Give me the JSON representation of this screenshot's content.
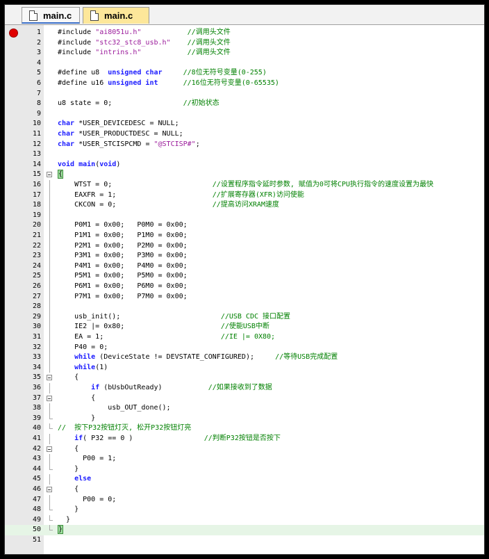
{
  "tabs": [
    {
      "label": "main.c",
      "active": false
    },
    {
      "label": "main.c",
      "active": true
    }
  ],
  "editor": {
    "breakpoint_line": 1,
    "current_line": 50,
    "lines": [
      {
        "n": "1",
        "segs": [
          [
            "",
            "#include "
          ],
          [
            "st",
            "\"ai8051u.h\""
          ],
          [
            "",
            "           "
          ],
          [
            "cm",
            "//调用头文件"
          ]
        ]
      },
      {
        "n": "2",
        "segs": [
          [
            "",
            "#include "
          ],
          [
            "st",
            "\"stc32_stc8_usb.h\""
          ],
          [
            "",
            "    "
          ],
          [
            "cm",
            "//调用头文件"
          ]
        ]
      },
      {
        "n": "3",
        "segs": [
          [
            "",
            "#include "
          ],
          [
            "st",
            "\"intrins.h\""
          ],
          [
            "",
            "           "
          ],
          [
            "cm",
            "//调用头文件"
          ]
        ]
      },
      {
        "n": "4",
        "segs": []
      },
      {
        "n": "5",
        "segs": [
          [
            "",
            "#define u8  "
          ],
          [
            "kw",
            "unsigned char"
          ],
          [
            "",
            "     "
          ],
          [
            "cm",
            "//8位无符号变量(0-255)"
          ]
        ]
      },
      {
        "n": "6",
        "segs": [
          [
            "",
            "#define u16 "
          ],
          [
            "kw",
            "unsigned int"
          ],
          [
            "",
            "      "
          ],
          [
            "cm",
            "//16位无符号变量(0-65535)"
          ]
        ]
      },
      {
        "n": "7",
        "segs": []
      },
      {
        "n": "8",
        "segs": [
          [
            "",
            "u8 state = 0;"
          ],
          [
            "",
            "                 "
          ],
          [
            "cm",
            "//初始状态"
          ]
        ]
      },
      {
        "n": "9",
        "segs": []
      },
      {
        "n": "10",
        "segs": [
          [
            "kw",
            "char"
          ],
          [
            "",
            " *USER_DEVICEDESC = NULL;"
          ]
        ]
      },
      {
        "n": "11",
        "segs": [
          [
            "kw",
            "char"
          ],
          [
            "",
            " *USER_PRODUCTDESC = NULL;"
          ]
        ]
      },
      {
        "n": "12",
        "segs": [
          [
            "kw",
            "char"
          ],
          [
            "",
            " *USER_STCISPCMD = "
          ],
          [
            "st",
            "\"@STCISP#\""
          ],
          [
            "",
            ";"
          ]
        ]
      },
      {
        "n": "13",
        "segs": []
      },
      {
        "n": "14",
        "segs": [
          [
            "kw",
            "void"
          ],
          [
            "",
            " "
          ],
          [
            "kw",
            "main"
          ],
          [
            "",
            "("
          ],
          [
            "kw",
            "void"
          ],
          [
            "",
            ")"
          ]
        ]
      },
      {
        "n": "15",
        "segs": [
          [
            "hl",
            "{"
          ]
        ]
      },
      {
        "n": "16",
        "segs": [
          [
            "",
            "    WTST = 0;"
          ],
          [
            "",
            "                        "
          ],
          [
            "cm",
            "//设置程序指令延时参数, 赋值为0可将CPU执行指令的速度设置为最快"
          ]
        ]
      },
      {
        "n": "17",
        "segs": [
          [
            "",
            "    EAXFR = 1;"
          ],
          [
            "",
            "                       "
          ],
          [
            "cm",
            "//扩展寄存器(XFR)访问使能"
          ]
        ]
      },
      {
        "n": "18",
        "segs": [
          [
            "",
            "    CKCON = 0;"
          ],
          [
            "",
            "                       "
          ],
          [
            "cm",
            "//提高访问XRAM速度"
          ]
        ]
      },
      {
        "n": "19",
        "segs": []
      },
      {
        "n": "20",
        "segs": [
          [
            "",
            "    P0M1 = 0x00;   P0M0 = 0x00;"
          ]
        ]
      },
      {
        "n": "21",
        "segs": [
          [
            "",
            "    P1M1 = 0x00;   P1M0 = 0x00;"
          ]
        ]
      },
      {
        "n": "22",
        "segs": [
          [
            "",
            "    P2M1 = 0x00;   P2M0 = 0x00;"
          ]
        ]
      },
      {
        "n": "23",
        "segs": [
          [
            "",
            "    P3M1 = 0x00;   P3M0 = 0x00;"
          ]
        ]
      },
      {
        "n": "24",
        "segs": [
          [
            "",
            "    P4M1 = 0x00;   P4M0 = 0x00;"
          ]
        ]
      },
      {
        "n": "25",
        "segs": [
          [
            "",
            "    P5M1 = 0x00;   P5M0 = 0x00;"
          ]
        ]
      },
      {
        "n": "26",
        "segs": [
          [
            "",
            "    P6M1 = 0x00;   P6M0 = 0x00;"
          ]
        ]
      },
      {
        "n": "27",
        "segs": [
          [
            "",
            "    P7M1 = 0x00;   P7M0 = 0x00;"
          ]
        ]
      },
      {
        "n": "28",
        "segs": []
      },
      {
        "n": "29",
        "segs": [
          [
            "",
            "    usb_init();"
          ],
          [
            "",
            "                        "
          ],
          [
            "cm",
            "//USB CDC 接口配置"
          ]
        ]
      },
      {
        "n": "30",
        "segs": [
          [
            "",
            "    IE2 |= 0x80;"
          ],
          [
            "",
            "                       "
          ],
          [
            "cm",
            "//使能USB中断"
          ]
        ]
      },
      {
        "n": "31",
        "segs": [
          [
            "",
            "    EA = 1;"
          ],
          [
            "",
            "                            "
          ],
          [
            "cm",
            "//IE |= 0X80;"
          ]
        ]
      },
      {
        "n": "32",
        "segs": [
          [
            "",
            "    P40 = 0;"
          ]
        ]
      },
      {
        "n": "33",
        "segs": [
          [
            "",
            "    "
          ],
          [
            "kw",
            "while"
          ],
          [
            "",
            " (DeviceState != DEVSTATE_CONFIGURED);     "
          ],
          [
            "cm",
            "//等待USB完成配置"
          ]
        ]
      },
      {
        "n": "34",
        "segs": [
          [
            "",
            "    "
          ],
          [
            "kw",
            "while"
          ],
          [
            "",
            "(1)"
          ]
        ]
      },
      {
        "n": "35",
        "segs": [
          [
            "",
            "    {"
          ]
        ]
      },
      {
        "n": "36",
        "segs": [
          [
            "",
            "        "
          ],
          [
            "kw",
            "if"
          ],
          [
            "",
            " (bUsbOutReady)"
          ],
          [
            "",
            "           "
          ],
          [
            "cm",
            "//如果接收到了数据"
          ]
        ]
      },
      {
        "n": "37",
        "segs": [
          [
            "",
            "        {"
          ]
        ]
      },
      {
        "n": "38",
        "segs": [
          [
            "",
            "            usb_OUT_done();"
          ]
        ]
      },
      {
        "n": "39",
        "segs": [
          [
            "",
            "        }"
          ]
        ]
      },
      {
        "n": "40",
        "segs": [
          [
            "cm",
            "//  按下P32按钮灯灭, 松开P32按钮灯亮"
          ]
        ]
      },
      {
        "n": "41",
        "segs": [
          [
            "",
            "    "
          ],
          [
            "kw",
            "if"
          ],
          [
            "",
            "( P32 == 0 )"
          ],
          [
            "",
            "                 "
          ],
          [
            "cm",
            "//判断P32按钮是否按下"
          ]
        ]
      },
      {
        "n": "42",
        "segs": [
          [
            "",
            "    {"
          ]
        ]
      },
      {
        "n": "43",
        "segs": [
          [
            "",
            "      P00 = 1;"
          ]
        ]
      },
      {
        "n": "44",
        "segs": [
          [
            "",
            "    }"
          ]
        ]
      },
      {
        "n": "45",
        "segs": [
          [
            "",
            "    "
          ],
          [
            "kw",
            "else"
          ]
        ]
      },
      {
        "n": "46",
        "segs": [
          [
            "",
            "    {"
          ]
        ]
      },
      {
        "n": "47",
        "segs": [
          [
            "",
            "      P00 = 0;"
          ]
        ]
      },
      {
        "n": "48",
        "segs": [
          [
            "",
            "    }"
          ]
        ]
      },
      {
        "n": "49",
        "segs": [
          [
            "",
            "  }"
          ]
        ]
      },
      {
        "n": "50",
        "segs": [
          [
            "hl",
            "}"
          ]
        ]
      },
      {
        "n": "51",
        "segs": []
      }
    ],
    "folds": {
      "15": "box",
      "16": "v",
      "17": "v",
      "18": "v",
      "19": "v",
      "20": "v",
      "21": "v",
      "22": "v",
      "23": "v",
      "24": "v",
      "25": "v",
      "26": "v",
      "27": "v",
      "28": "v",
      "29": "v",
      "30": "v",
      "31": "v",
      "32": "v",
      "33": "v",
      "34": "v",
      "35": "box",
      "36": "v",
      "37": "box",
      "38": "v",
      "39": "end",
      "40": "end",
      "41": "v",
      "42": "box",
      "43": "v",
      "44": "end",
      "45": "v",
      "46": "box",
      "47": "v",
      "48": "end",
      "49": "end",
      "50": "end"
    }
  }
}
